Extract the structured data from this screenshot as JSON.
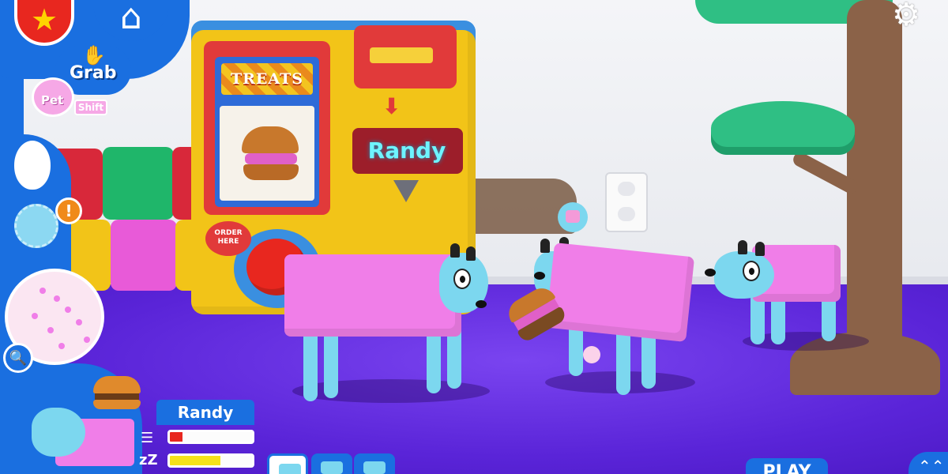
{
  "scene": {
    "vending_sign": "TREATS",
    "order_sign": "ORDER HERE",
    "active_dog_name_tag": "Randy"
  },
  "hud": {
    "top_left": {
      "favorite_icon": "star-icon",
      "home_icon": "house-icon",
      "grab_label": "Grab",
      "pet_label": "Pet",
      "shift_key_label": "Shift"
    },
    "side": {
      "egg_icon": "egg-icon",
      "germ_icon": "germ-icon",
      "alert_symbol": "!",
      "zoom_icon": "magnifier-plus-icon"
    },
    "pet_card": {
      "name": "Randy",
      "hunger_icon": "burger-icon",
      "sleep_symbol": "zZ",
      "hunger_level": 0.15,
      "energy_level": 0.62,
      "hunger_color": "#e8271f",
      "energy_color": "#f5e21a"
    },
    "bottom_right": {
      "play_label": "PLAY",
      "settings_icon": "gear-icon"
    }
  },
  "colors": {
    "hud_blue": "#1a6fe0",
    "dog_body": "#f07ee8",
    "dog_skin": "#7cd7ef",
    "floor": "#5a24d8"
  }
}
